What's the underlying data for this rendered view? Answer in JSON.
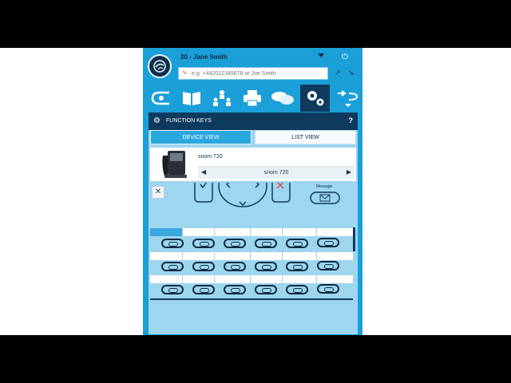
{
  "header": {
    "user": "20 - Jane Smith",
    "search_placeholder": "e.g. +442012345678 or Joe Smith"
  },
  "toolbar": {
    "items": [
      {
        "name": "horn",
        "icon": "horn-icon"
      },
      {
        "name": "directory",
        "icon": "book-icon"
      },
      {
        "name": "org-chart",
        "icon": "org-chart-icon"
      },
      {
        "name": "fax",
        "icon": "fax-icon"
      },
      {
        "name": "chat",
        "icon": "chat-bubbles-icon"
      },
      {
        "name": "settings",
        "icon": "gears-icon",
        "active": true
      },
      {
        "name": "transfer",
        "icon": "transfer-arrows-icon"
      }
    ]
  },
  "panel": {
    "title": "FUNCTION KEYS",
    "help": "?",
    "tabs": [
      {
        "label": "DEVICE VIEW",
        "active": true
      },
      {
        "label": "LIST VIEW",
        "active": false
      }
    ],
    "device_name": "snom 720",
    "device_model": "snom 720",
    "message_label": "Message"
  },
  "colors": {
    "app_bg": "#1b9fd8",
    "dark": "#0e3a5e",
    "panel_bg": "#9ed5ef",
    "selection": "#3aa7df"
  }
}
